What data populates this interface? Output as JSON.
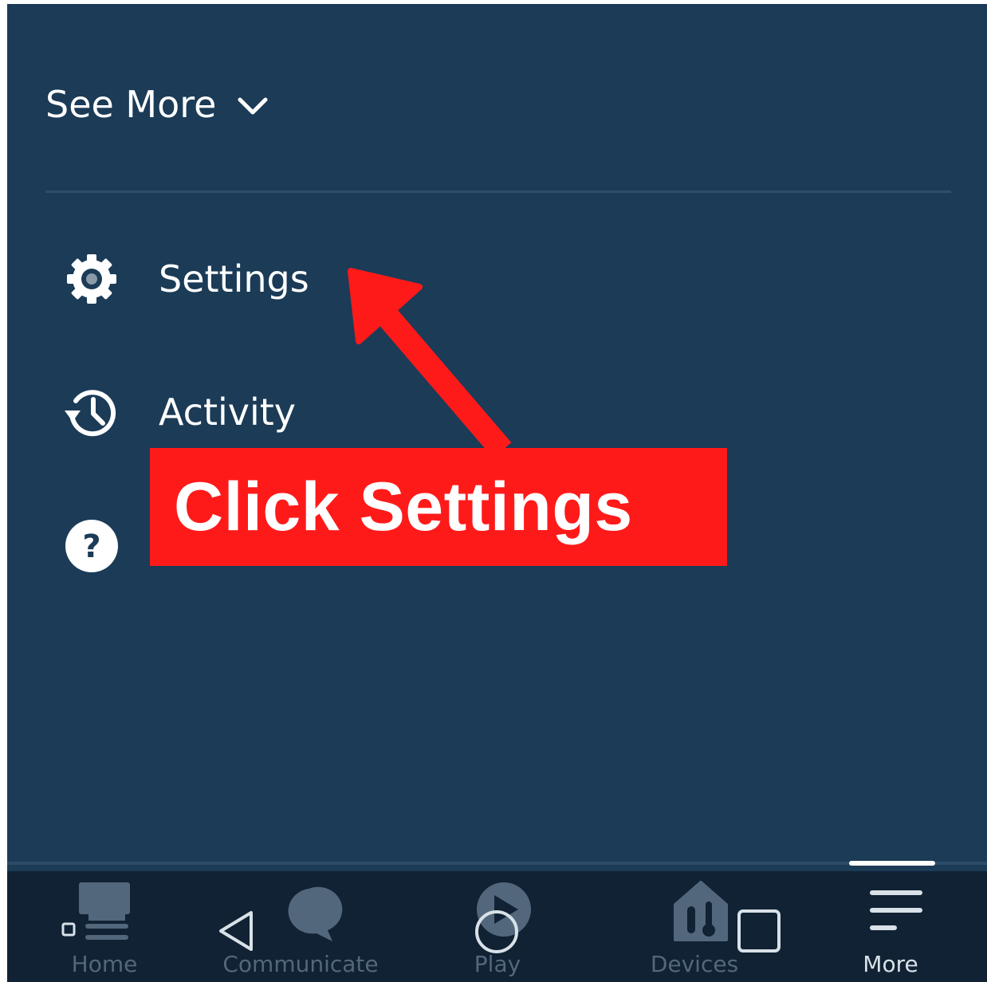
{
  "header": {
    "see_more_label": "See More"
  },
  "menu": {
    "items": [
      {
        "id": "settings",
        "label": "Settings",
        "icon": "gear-icon"
      },
      {
        "id": "activity",
        "label": "Activity",
        "icon": "history-icon"
      },
      {
        "id": "help",
        "label": "",
        "icon": "help-icon"
      }
    ]
  },
  "tabbar": {
    "active": "more",
    "tabs": [
      {
        "id": "home",
        "label": "Home",
        "icon": "home-icon"
      },
      {
        "id": "communicate",
        "label": "Communicate",
        "icon": "chat-bubble-icon"
      },
      {
        "id": "play",
        "label": "Play",
        "icon": "play-icon"
      },
      {
        "id": "devices",
        "label": "Devices",
        "icon": "devices-icon"
      },
      {
        "id": "more",
        "label": "More",
        "icon": "hamburger-menu-icon"
      }
    ]
  },
  "annotation": {
    "callout_text": "Click Settings",
    "color": "#ff1a1a"
  },
  "colors": {
    "background": "#1b3b57",
    "tabbar_background": "#102233",
    "text": "#ffffff",
    "inactive_tab": "#53677c"
  }
}
